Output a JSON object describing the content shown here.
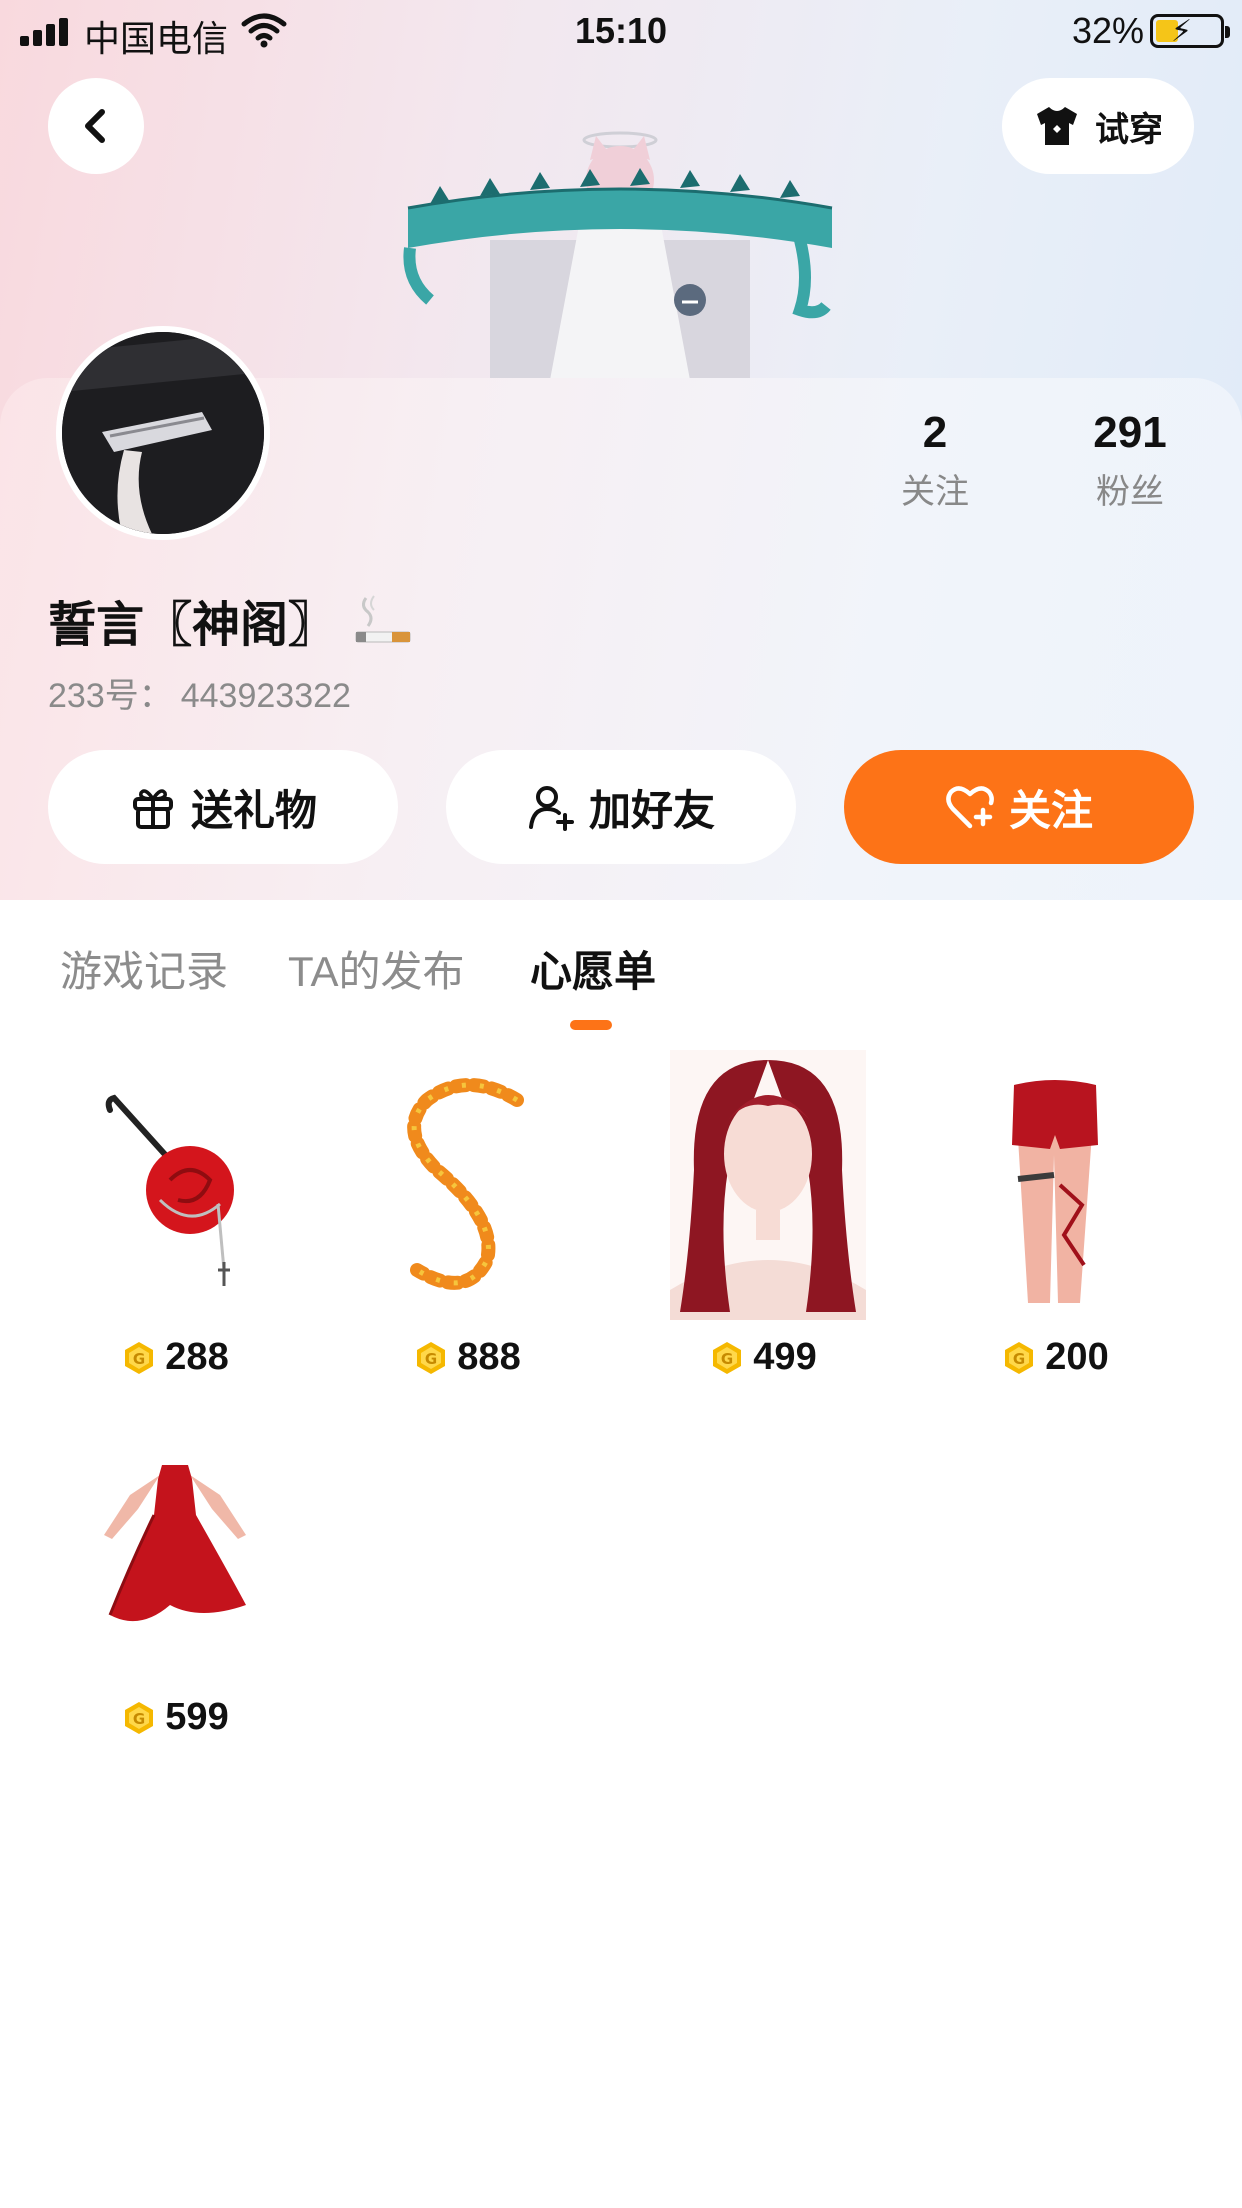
{
  "status_bar": {
    "carrier": "中国电信",
    "time": "15:10",
    "battery": "32%",
    "battery_level": 0.32
  },
  "header": {
    "back_icon": "chevron-left-icon",
    "tryon_label": "试穿",
    "tryon_icon": "shirt-icon"
  },
  "profile": {
    "nickname": "誓言〖神阁〗",
    "uid_label": "233号：",
    "uid_value": "443923322",
    "stats": {
      "following_count": "2",
      "following_label": "关注",
      "fans_count": "291",
      "fans_label": "粉丝"
    }
  },
  "actions": {
    "gift_label": "送礼物",
    "add_friend_label": "加好友",
    "follow_label": "关注"
  },
  "tabs": [
    {
      "label": "游戏记录",
      "active": false
    },
    {
      "label": "TA的发布",
      "active": false
    },
    {
      "label": "心愿单",
      "active": true
    }
  ],
  "wishlist": [
    {
      "name": "rose-accessory",
      "price": "288"
    },
    {
      "name": "leaf-trail-effect",
      "price": "888"
    },
    {
      "name": "red-long-hair",
      "price": "499"
    },
    {
      "name": "red-shorts-legs",
      "price": "200"
    },
    {
      "name": "red-dress",
      "price": "599"
    }
  ],
  "colors": {
    "accent": "#fd7317",
    "coin": "#f5b800"
  }
}
